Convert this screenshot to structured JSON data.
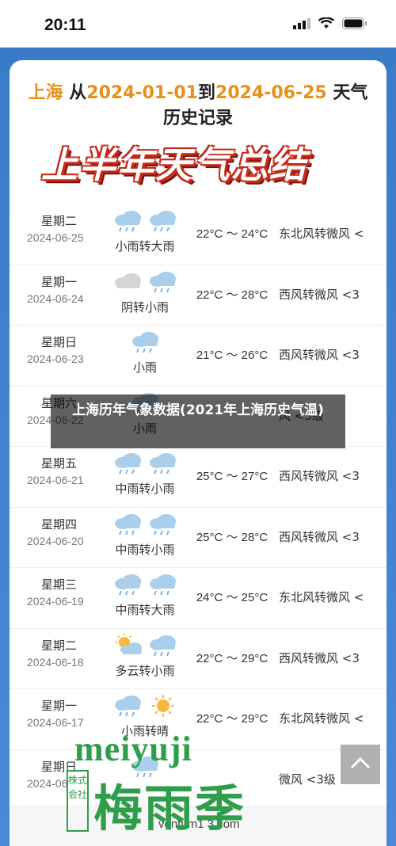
{
  "status_bar": {
    "time": "20:11"
  },
  "headline": {
    "city": "上海",
    "from_word": "从",
    "start_date": "2024-01-01",
    "to_word": "到",
    "end_date": "2024-06-25",
    "suffix": "天气历史记录"
  },
  "banner": {
    "text": "上半年天气总结"
  },
  "rows": [
    {
      "day": "星期二",
      "date": "2024-06-25",
      "icons": [
        "rain-icon",
        "rain-icon"
      ],
      "condition": "小雨转大雨",
      "temp": "22°C ～ 24°C",
      "wind": "东北风转微风 <"
    },
    {
      "day": "星期一",
      "date": "2024-06-24",
      "icons": [
        "overcast-icon",
        "rain-icon"
      ],
      "condition": "阴转小雨",
      "temp": "22°C ～ 28°C",
      "wind": "西风转微风 <3"
    },
    {
      "day": "星期日",
      "date": "2024-06-23",
      "icons": [
        "rain-icon"
      ],
      "condition": "小雨",
      "temp": "21°C ～ 26°C",
      "wind": "西风转微风 <3"
    },
    {
      "day": "星期六",
      "date": "2024-06-22",
      "icons": [
        "rain-icon"
      ],
      "condition": "小雨",
      "temp": "",
      "wind": "风 <3级"
    },
    {
      "day": "星期五",
      "date": "2024-06-21",
      "icons": [
        "rain-icon",
        "rain-icon"
      ],
      "condition": "中雨转小雨",
      "temp": "25°C ～ 27°C",
      "wind": "西风转微风 <3"
    },
    {
      "day": "星期四",
      "date": "2024-06-20",
      "icons": [
        "rain-icon",
        "rain-icon"
      ],
      "condition": "中雨转小雨",
      "temp": "25°C ～ 28°C",
      "wind": "西风转微风 <3"
    },
    {
      "day": "星期三",
      "date": "2024-06-19",
      "icons": [
        "rain-icon",
        "rain-icon"
      ],
      "condition": "中雨转大雨",
      "temp": "24°C ～ 25°C",
      "wind": "东北风转微风 <"
    },
    {
      "day": "星期二",
      "date": "2024-06-18",
      "icons": [
        "partly-cloudy-icon",
        "rain-icon"
      ],
      "condition": "多云转小雨",
      "temp": "22°C ～ 29°C",
      "wind": "西风转微风 <3"
    },
    {
      "day": "星期一",
      "date": "2024-06-17",
      "icons": [
        "rain-icon",
        "sun-icon"
      ],
      "condition": "小雨转晴",
      "temp": "22°C ～ 29°C",
      "wind": "东北风转微风 <"
    },
    {
      "day": "星期日",
      "date": "2024-06",
      "icons": [
        "rain-icon"
      ],
      "condition": "",
      "temp": "",
      "wind": "微风 <3级"
    }
  ],
  "overlay": {
    "text": "上海历年气象数据(2021年上海历史气温)"
  },
  "watermark": {
    "latin": "meiyuji",
    "cjk": "梅雨季",
    "seal": "株式会社"
  },
  "footer": {
    "url": "ventum1 3.com"
  },
  "colors": {
    "accent": "#e8901a",
    "banner_red": "#c62a1b",
    "brand_blue": "#3a7bc8",
    "watermark_green": "#2e9e4a"
  }
}
